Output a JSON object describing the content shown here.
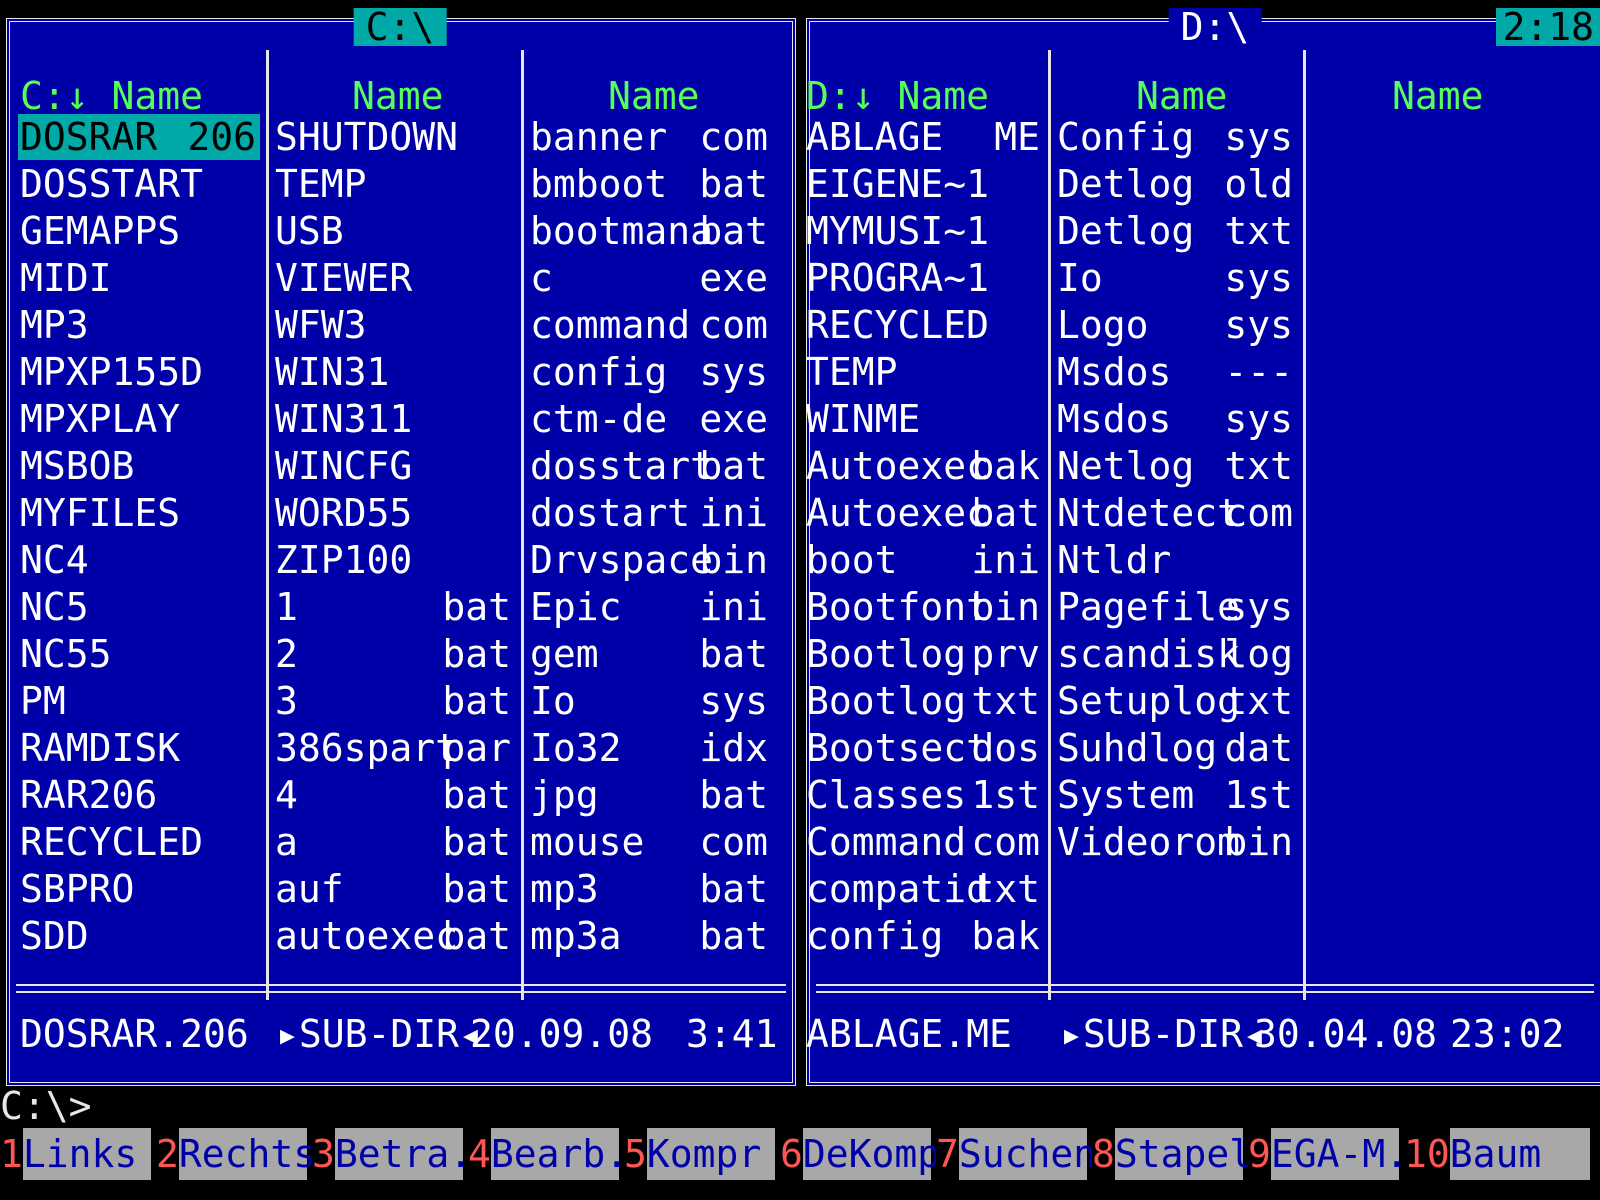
{
  "left_panel": {
    "title": "C:\\",
    "headers": [
      "C:↓ Name",
      "Name",
      "Name"
    ],
    "columns": [
      [
        {
          "name": "DOSRAR",
          "ext": "206"
        },
        {
          "name": "DOSSTART",
          "ext": ""
        },
        {
          "name": "GEMAPPS",
          "ext": ""
        },
        {
          "name": "MIDI",
          "ext": ""
        },
        {
          "name": "MP3",
          "ext": ""
        },
        {
          "name": "MPXP155D",
          "ext": ""
        },
        {
          "name": "MPXPLAY",
          "ext": ""
        },
        {
          "name": "MSBOB",
          "ext": ""
        },
        {
          "name": "MYFILES",
          "ext": ""
        },
        {
          "name": "NC4",
          "ext": ""
        },
        {
          "name": "NC5",
          "ext": ""
        },
        {
          "name": "NC55",
          "ext": ""
        },
        {
          "name": "PM",
          "ext": ""
        },
        {
          "name": "RAMDISK",
          "ext": ""
        },
        {
          "name": "RAR206",
          "ext": ""
        },
        {
          "name": "RECYCLED",
          "ext": ""
        },
        {
          "name": "SBPRO",
          "ext": ""
        },
        {
          "name": "SDD",
          "ext": ""
        }
      ],
      [
        {
          "name": "SHUTDOWN",
          "ext": ""
        },
        {
          "name": "TEMP",
          "ext": ""
        },
        {
          "name": "USB",
          "ext": ""
        },
        {
          "name": "VIEWER",
          "ext": ""
        },
        {
          "name": "WFW3",
          "ext": ""
        },
        {
          "name": "WIN31",
          "ext": ""
        },
        {
          "name": "WIN311",
          "ext": ""
        },
        {
          "name": "WINCFG",
          "ext": ""
        },
        {
          "name": "WORD55",
          "ext": ""
        },
        {
          "name": "ZIP100",
          "ext": ""
        },
        {
          "name": "1",
          "ext": "bat"
        },
        {
          "name": "2",
          "ext": "bat"
        },
        {
          "name": "3",
          "ext": "bat"
        },
        {
          "name": "386spart",
          "ext": "par"
        },
        {
          "name": "4",
          "ext": "bat"
        },
        {
          "name": "a",
          "ext": "bat"
        },
        {
          "name": "auf",
          "ext": "bat"
        },
        {
          "name": "autoexec",
          "ext": "bat"
        }
      ],
      [
        {
          "name": "banner",
          "ext": "com"
        },
        {
          "name": "bmboot",
          "ext": "bat"
        },
        {
          "name": "bootmana",
          "ext": "bat"
        },
        {
          "name": "c",
          "ext": "exe"
        },
        {
          "name": "command",
          "ext": "com"
        },
        {
          "name": "config",
          "ext": "sys"
        },
        {
          "name": "ctm-de",
          "ext": "exe"
        },
        {
          "name": "dosstart",
          "ext": "bat"
        },
        {
          "name": "dostart",
          "ext": "ini"
        },
        {
          "name": "Drvspace",
          "ext": "bin"
        },
        {
          "name": "Epic",
          "ext": "ini"
        },
        {
          "name": "gem",
          "ext": "bat"
        },
        {
          "name": "Io",
          "ext": "sys"
        },
        {
          "name": "Io32",
          "ext": "idx"
        },
        {
          "name": "jpg",
          "ext": "bat"
        },
        {
          "name": "mouse",
          "ext": "com"
        },
        {
          "name": "mp3",
          "ext": "bat"
        },
        {
          "name": "mp3a",
          "ext": "bat"
        }
      ]
    ],
    "status": {
      "name": "DOSRAR.206",
      "type": "▸SUB-DIR◂",
      "date": "20.09.08",
      "time": "3:41"
    }
  },
  "right_panel": {
    "title": "D:\\",
    "clock": "2:18",
    "headers": [
      "D:↓ Name",
      "Name",
      "Name"
    ],
    "columns": [
      [
        {
          "name": "ABLAGE",
          "ext": "ME"
        },
        {
          "name": "EIGENE~1",
          "ext": ""
        },
        {
          "name": "MYMUSI~1",
          "ext": ""
        },
        {
          "name": "PROGRA~1",
          "ext": ""
        },
        {
          "name": "RECYCLED",
          "ext": ""
        },
        {
          "name": "TEMP",
          "ext": ""
        },
        {
          "name": "WINME",
          "ext": ""
        },
        {
          "name": "Autoexec",
          "ext": "bak"
        },
        {
          "name": "Autoexec",
          "ext": "bat"
        },
        {
          "name": "boot",
          "ext": "ini"
        },
        {
          "name": "Bootfont",
          "ext": "bin"
        },
        {
          "name": "Bootlog",
          "ext": "prv"
        },
        {
          "name": "Bootlog",
          "ext": "txt"
        },
        {
          "name": "Bootsect",
          "ext": "dos"
        },
        {
          "name": "Classes",
          "ext": "1st"
        },
        {
          "name": "Command",
          "ext": "com"
        },
        {
          "name": "compatid",
          "ext": "txt"
        },
        {
          "name": "config",
          "ext": "bak"
        }
      ],
      [
        {
          "name": "Config",
          "ext": "sys"
        },
        {
          "name": "Detlog",
          "ext": "old"
        },
        {
          "name": "Detlog",
          "ext": "txt"
        },
        {
          "name": "Io",
          "ext": "sys"
        },
        {
          "name": "Logo",
          "ext": "sys"
        },
        {
          "name": "Msdos",
          "ext": "---"
        },
        {
          "name": "Msdos",
          "ext": "sys"
        },
        {
          "name": "Netlog",
          "ext": "txt"
        },
        {
          "name": "Ntdetect",
          "ext": "com"
        },
        {
          "name": "Ntldr",
          "ext": ""
        },
        {
          "name": "Pagefile",
          "ext": "sys"
        },
        {
          "name": "scandisk",
          "ext": "log"
        },
        {
          "name": "Setuplog",
          "ext": "txt"
        },
        {
          "name": "Suhdlog",
          "ext": "dat"
        },
        {
          "name": "System",
          "ext": "1st"
        },
        {
          "name": "Videorom",
          "ext": "bin"
        }
      ],
      []
    ],
    "status": {
      "name": "ABLAGE.ME",
      "type": "▸SUB-DIR◂",
      "date": "30.04.08",
      "time": "23:02"
    }
  },
  "command_line": "C:\\>",
  "function_keys": [
    {
      "num": "1",
      "label": "Links"
    },
    {
      "num": "2",
      "label": "Rechts"
    },
    {
      "num": "3",
      "label": "Betra."
    },
    {
      "num": "4",
      "label": "Bearb."
    },
    {
      "num": "5",
      "label": "Kompr"
    },
    {
      "num": "6",
      "label": "DeKomp"
    },
    {
      "num": "7",
      "label": "Suchen"
    },
    {
      "num": "8",
      "label": "Stapel"
    },
    {
      "num": "9",
      "label": "EGA-M."
    },
    {
      "num": "10",
      "label": "Baum"
    }
  ],
  "colors": {
    "panel_bg": "#0000a8",
    "selection": "#00a8a8",
    "header_text": "#55ff55",
    "key_number": "#ff5555",
    "key_bg": "#a8a8a8"
  }
}
